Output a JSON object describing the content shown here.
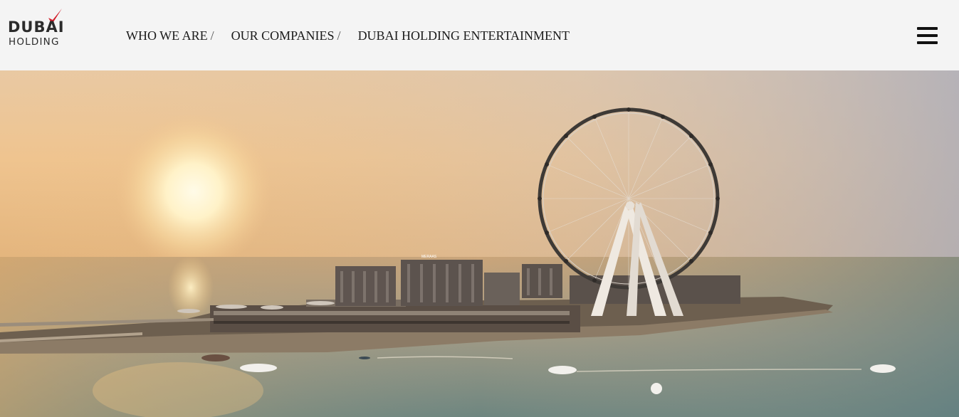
{
  "brand": {
    "line1": "DUBAI",
    "line2": "HOLDING",
    "accent_color": "#d21f2b",
    "text_color": "#2b2b2b"
  },
  "breadcrumb": [
    {
      "label": "WHO WE ARE",
      "separator": "/"
    },
    {
      "label": "OUR COMPANIES",
      "separator": "/"
    },
    {
      "label": "DUBAI HOLDING ENTERTAINMENT",
      "separator": ""
    }
  ],
  "menu": {
    "icon": "hamburger-menu-icon"
  },
  "hero": {
    "image": "sunset-ferris-wheel-island-photo",
    "building_sign": "MERAAS"
  }
}
